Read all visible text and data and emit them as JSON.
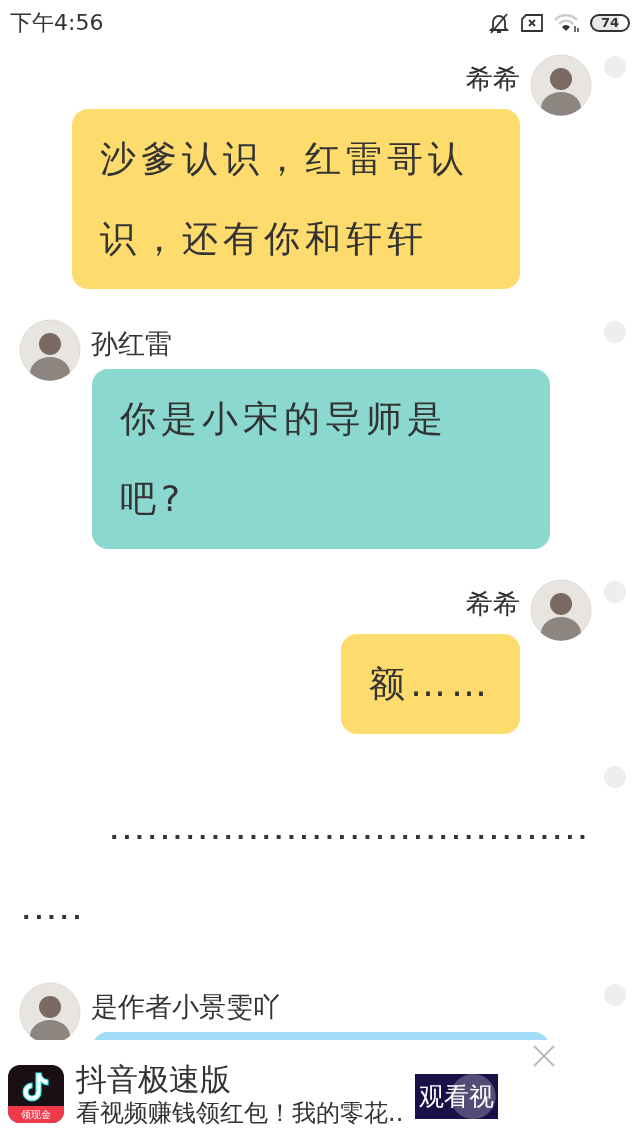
{
  "status_bar": {
    "time": "下午4:56",
    "battery": "74"
  },
  "items": [
    {
      "kind": "sent",
      "name": "希希",
      "text": "沙爹认识，红雷哥认识，还有你和轩轩",
      "color": "#fddb6d",
      "selected": false
    },
    {
      "kind": "received",
      "name": "孙红雷",
      "text": "你是小宋的导师是吧?",
      "color": "#8ad8cf",
      "selected": false
    },
    {
      "kind": "sent",
      "name": "希希",
      "text": "额……",
      "color": "#fddb6d",
      "selected": false
    },
    {
      "kind": "narration",
      "text": "...........................................",
      "selected": false
    },
    {
      "kind": "received",
      "name": "是作者小景雯吖",
      "color": "#a3dcf6",
      "selected": false
    }
  ],
  "ad": {
    "badge": "领现金",
    "title": "抖音极速版",
    "subtitle": "看视频赚钱领红包！我的零花..",
    "button": "观看视"
  }
}
